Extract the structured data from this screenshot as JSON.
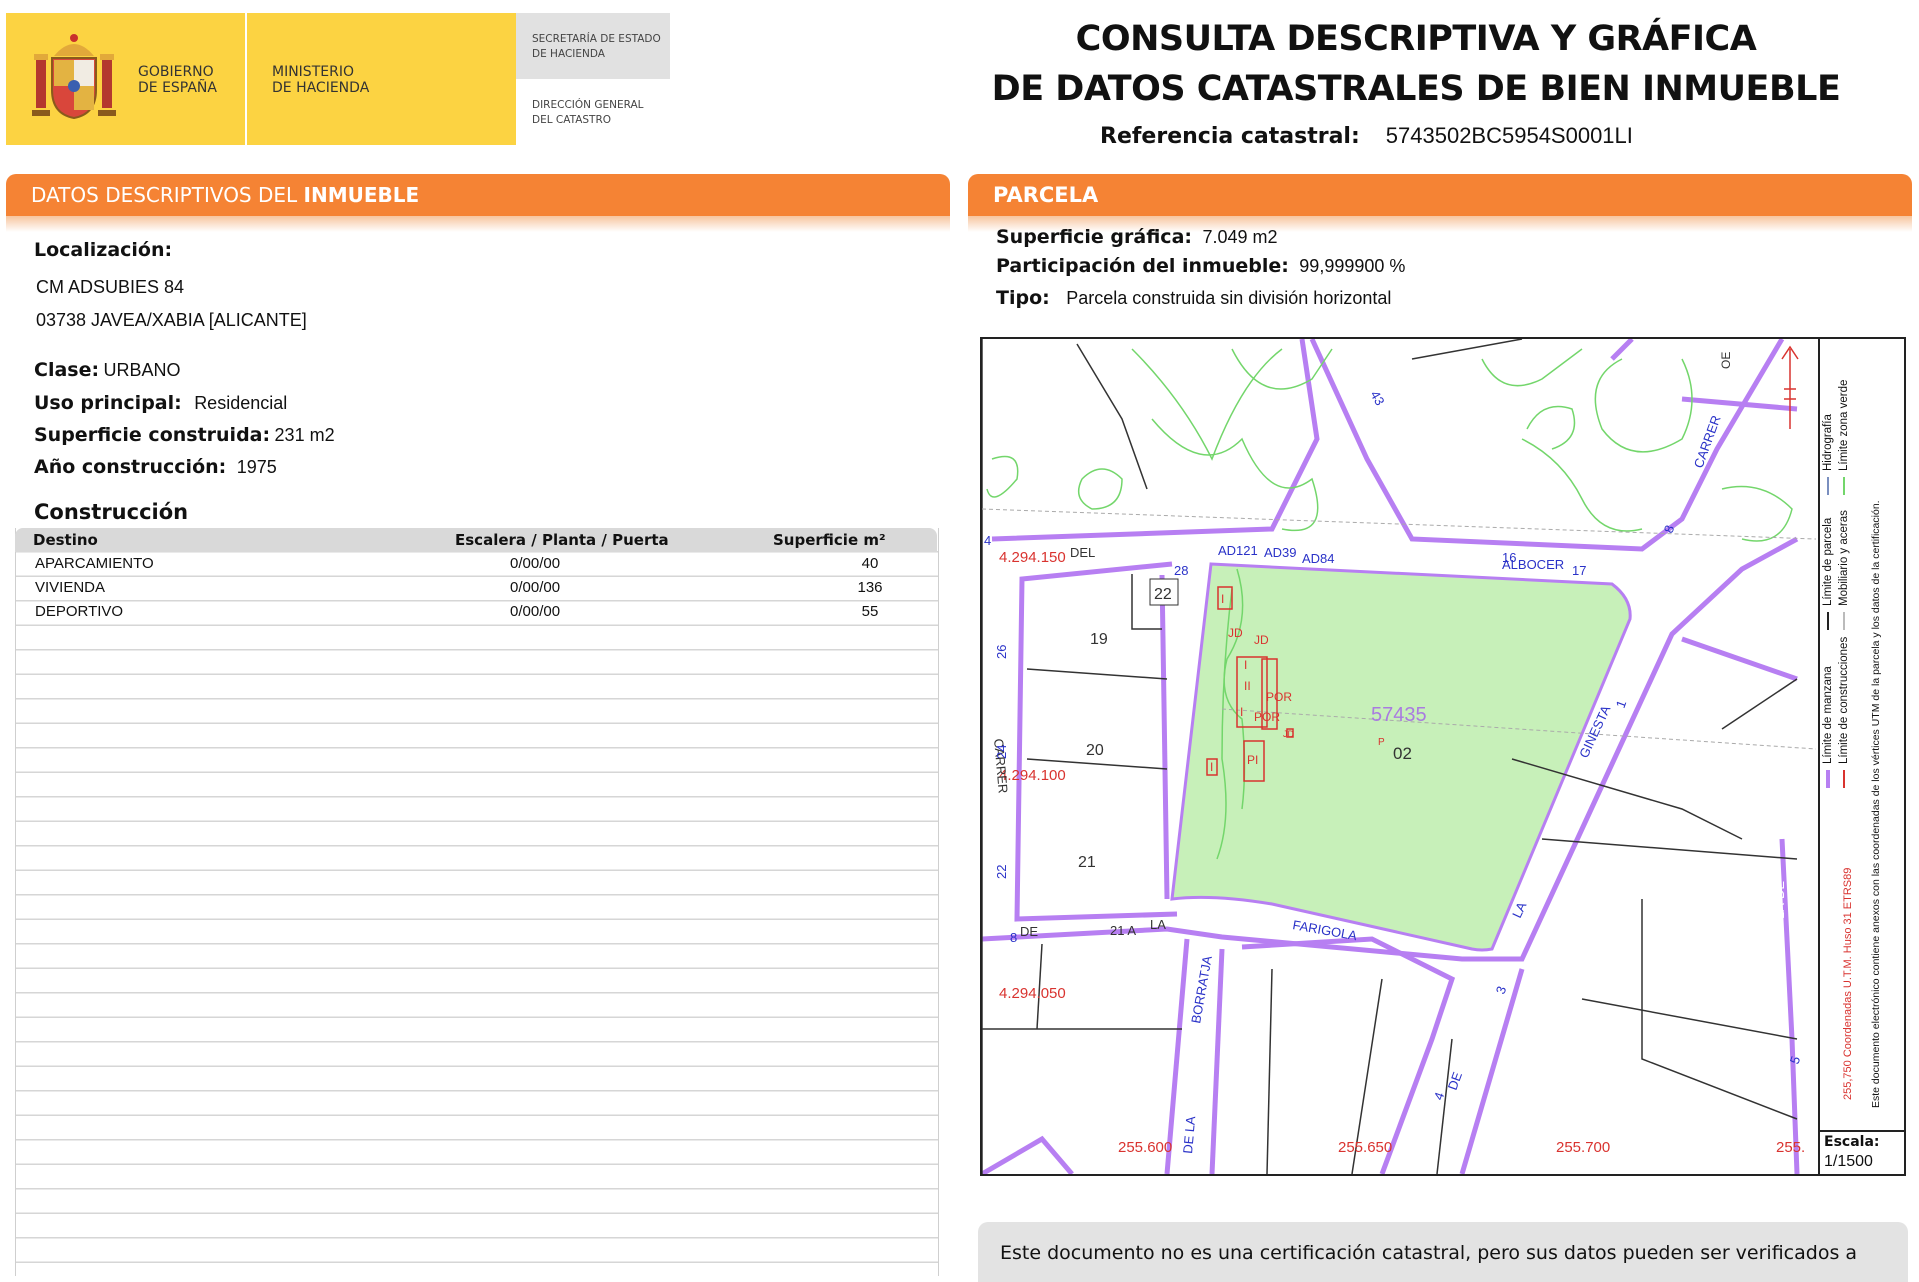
{
  "logo": {
    "line1a": "GOBIERNO",
    "line1b": "DE ESPAÑA",
    "line2a": "MINISTERIO",
    "line2b": "DE HACIENDA",
    "sec1": "SECRETARÍA DE ESTADO",
    "sec2": "DE HACIENDA",
    "dir1": "DIRECCIÓN GENERAL",
    "dir2": "DEL CATASTRO"
  },
  "title": {
    "line1": "CONSULTA DESCRIPTIVA Y GRÁFICA",
    "line2": "DE DATOS CATASTRALES DE BIEN INMUEBLE",
    "ref_label": "Referencia catastral:",
    "ref_value": "5743502BC5954S0001LI"
  },
  "left": {
    "header_a": "DATOS DESCRIPTIVOS DEL ",
    "header_b": "INMUEBLE",
    "localizacion_label": "Localización:",
    "address1": "CM ADSUBIES 84",
    "address2": "03738 JAVEA/XABIA [ALICANTE]",
    "clase_label": "Clase:",
    "clase_value": "URBANO",
    "uso_label": "Uso principal:",
    "uso_value": "Residencial",
    "sup_label": "Superficie construida:",
    "sup_value": "231 m2",
    "anio_label": "Año construcción:",
    "anio_value": "1975",
    "construccion_label": "Construcción",
    "table": {
      "headers": [
        "Destino",
        "Escalera / Planta / Puerta",
        "Superficie m²"
      ],
      "rows": [
        [
          "APARCAMIENTO",
          "0/00/00",
          "40"
        ],
        [
          "VIVIENDA",
          "0/00/00",
          "136"
        ],
        [
          "DEPORTIVO",
          "0/00/00",
          "55"
        ]
      ]
    }
  },
  "right": {
    "header": "PARCELA",
    "sup_label": "Superficie gráfica:",
    "sup_value": "7.049 m2",
    "part_label": "Participación del inmueble:",
    "part_value": "99,999900 %",
    "tipo_label": "Tipo:",
    "tipo_value": "Parcela construida sin división horizontal"
  },
  "map": {
    "parcel_id": "57435",
    "sub_id": "02",
    "y_coords": [
      "4.294.150",
      "4.294.100",
      "4.294.050"
    ],
    "x_coords": [
      "255.600",
      "255.650",
      "255.700",
      "255."
    ],
    "street_labels": [
      "AD121",
      "AD39",
      "AD84",
      "DEL",
      "ALBOCER",
      "CARRER",
      "GINESTA",
      "FARIGOLA",
      "BORRATJA",
      "DE LA",
      "DE",
      "LA",
      "CARRER",
      "21 A",
      "LA",
      "DE",
      "DE",
      "LA"
    ],
    "numbers": [
      "28",
      "22",
      "19",
      "20",
      "21",
      "26",
      "24",
      "22",
      "16",
      "17",
      "1",
      "3",
      "4",
      "8",
      "8",
      "5",
      "43",
      "4",
      "OE"
    ],
    "building_labels": [
      "I",
      "JD",
      "JD",
      "I",
      "II",
      "POR",
      "I",
      "POR",
      "PI",
      "I",
      "JD",
      "P"
    ],
    "legend": {
      "l1": "Límite de manzana",
      "l2": "Límite de construcciones",
      "l3": "Límite de parcela",
      "l4": "Mobiliario y aceras",
      "l5": "Hidrografía",
      "l6": "Límite zona verde",
      "coords_note": "255,750 Coordenadas U.T.M. Huso 31 ETRS89",
      "doc_note": "Este documento electrónico contiene anexos con las coordenadas de los vértices UTM de la parcela y los datos de la certificación."
    },
    "scale_label": "Escala:",
    "scale_value": "1/1500"
  },
  "note": {
    "text": "Este documento no es una certificación catastral, pero sus datos pueden ser verificados a"
  },
  "colors": {
    "orange": "#f58334",
    "yellow": "#fcd342",
    "parcel_fill": "#c7f0b9",
    "purple": "#b77ff2",
    "green_line": "#73d66b",
    "red": "#d9332f",
    "blue_text": "#2a32c8"
  }
}
